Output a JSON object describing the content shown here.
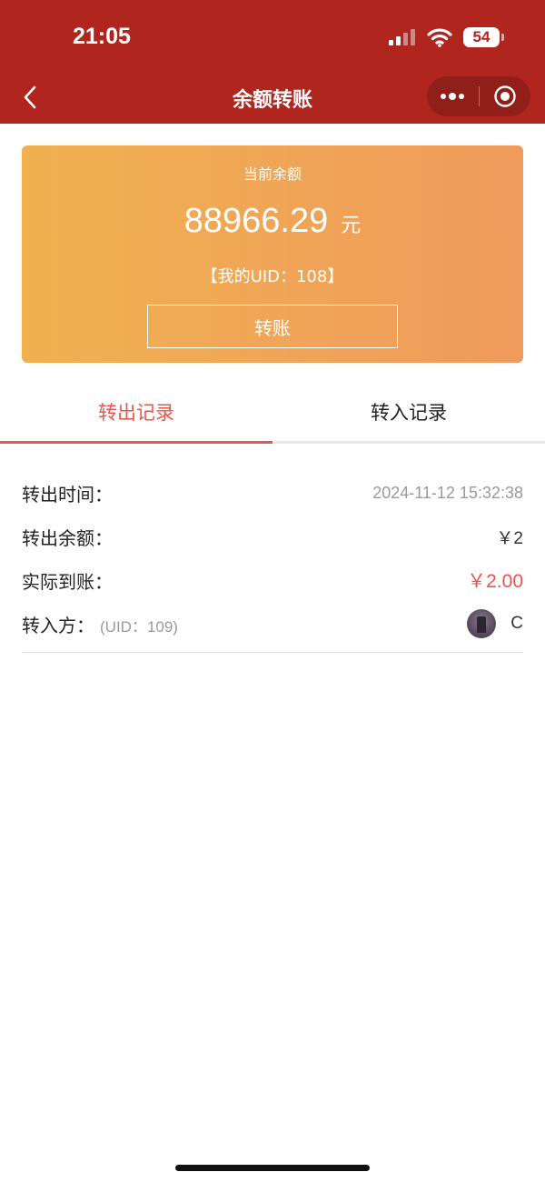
{
  "status_bar": {
    "time": "21:05",
    "battery": "54"
  },
  "nav": {
    "title": "余额转账"
  },
  "balance_card": {
    "label": "当前余额",
    "amount": "88966.29",
    "unit": "元",
    "uid_text": "【我的UID：108】",
    "transfer_button": "转账"
  },
  "tabs": [
    {
      "label": "转出记录",
      "active": true
    },
    {
      "label": "转入记录",
      "active": false
    }
  ],
  "record": {
    "time_label": "转出时间：",
    "time_value": "2024-11-12 15:32:38",
    "amount_label": "转出余额：",
    "amount_value": "￥2",
    "actual_label": "实际到账：",
    "actual_value": "￥2.00",
    "recipient_label": "转入方：",
    "recipient_uid": "(UID：109)",
    "recipient_name": "C"
  },
  "colors": {
    "header_bg": "#b0261f",
    "card_gradient_start": "#f1b150",
    "card_gradient_end": "#ef9b5c",
    "accent_red": "#e8564d"
  },
  "icons": {
    "back": "chevron-left-icon",
    "more": "more-dots-icon",
    "close": "target-circle-icon",
    "signal": "signal-icon",
    "wifi": "wifi-icon",
    "battery": "battery-icon"
  }
}
